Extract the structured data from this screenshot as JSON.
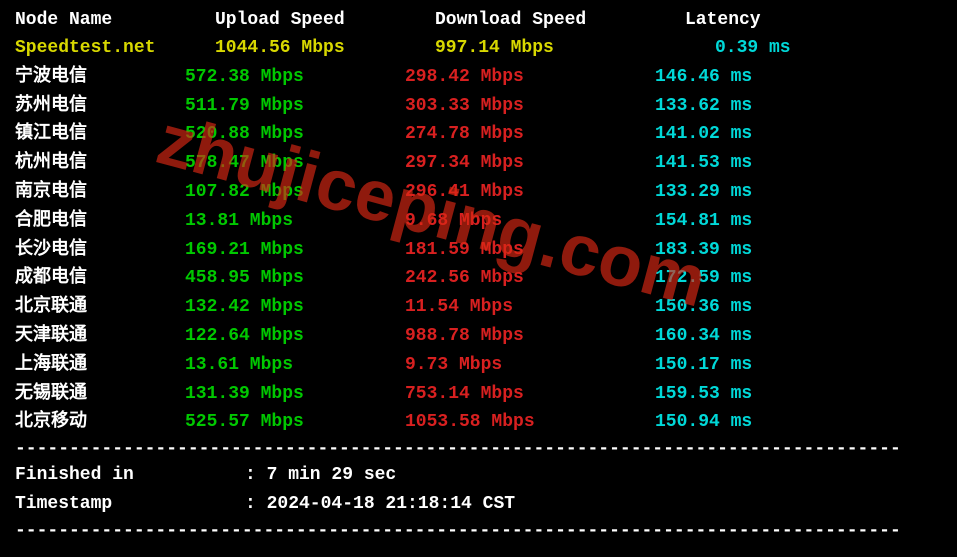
{
  "headers": {
    "node": "Node Name",
    "upload": "Upload Speed",
    "download": "Download Speed",
    "latency": "Latency"
  },
  "rows": [
    {
      "node": "Speedtest.net",
      "upload": "1044.56 Mbps",
      "download": "997.14 Mbps",
      "latency": "0.39 ms",
      "special": true
    },
    {
      "node": "宁波电信",
      "upload": "572.38 Mbps",
      "download": "298.42 Mbps",
      "latency": "146.46 ms"
    },
    {
      "node": "苏州电信",
      "upload": "511.79 Mbps",
      "download": "303.33 Mbps",
      "latency": "133.62 ms"
    },
    {
      "node": "镇江电信",
      "upload": "520.88 Mbps",
      "download": "274.78 Mbps",
      "latency": "141.02 ms"
    },
    {
      "node": "杭州电信",
      "upload": "578.47 Mbps",
      "download": "297.34 Mbps",
      "latency": "141.53 ms"
    },
    {
      "node": "南京电信",
      "upload": "107.82 Mbps",
      "download": "296.41 Mbps",
      "latency": "133.29 ms"
    },
    {
      "node": "合肥电信",
      "upload": "13.81 Mbps",
      "download": "9.68 Mbps",
      "latency": "154.81 ms"
    },
    {
      "node": "长沙电信",
      "upload": "169.21 Mbps",
      "download": "181.59 Mbps",
      "latency": "183.39 ms"
    },
    {
      "node": "成都电信",
      "upload": "458.95 Mbps",
      "download": "242.56 Mbps",
      "latency": "172.59 ms"
    },
    {
      "node": "北京联通",
      "upload": "132.42 Mbps",
      "download": "11.54 Mbps",
      "latency": "150.36 ms"
    },
    {
      "node": "天津联通",
      "upload": "122.64 Mbps",
      "download": "988.78 Mbps",
      "latency": "160.34 ms"
    },
    {
      "node": "上海联通",
      "upload": "13.61 Mbps",
      "download": "9.73 Mbps",
      "latency": "150.17 ms"
    },
    {
      "node": "无锡联通",
      "upload": "131.39 Mbps",
      "download": "753.14 Mbps",
      "latency": "159.53 ms"
    },
    {
      "node": "北京移动",
      "upload": "525.57 Mbps",
      "download": "1053.58 Mbps",
      "latency": "150.94 ms"
    }
  ],
  "divider": "----------------------------------------------------------------------------------",
  "footer": {
    "finished_label": "Finished in",
    "finished_value": ": 7 min 29 sec",
    "timestamp_label": "Timestamp",
    "timestamp_value": ": 2024-04-18 21:18:14 CST"
  },
  "watermark": "zhujiceping.com"
}
